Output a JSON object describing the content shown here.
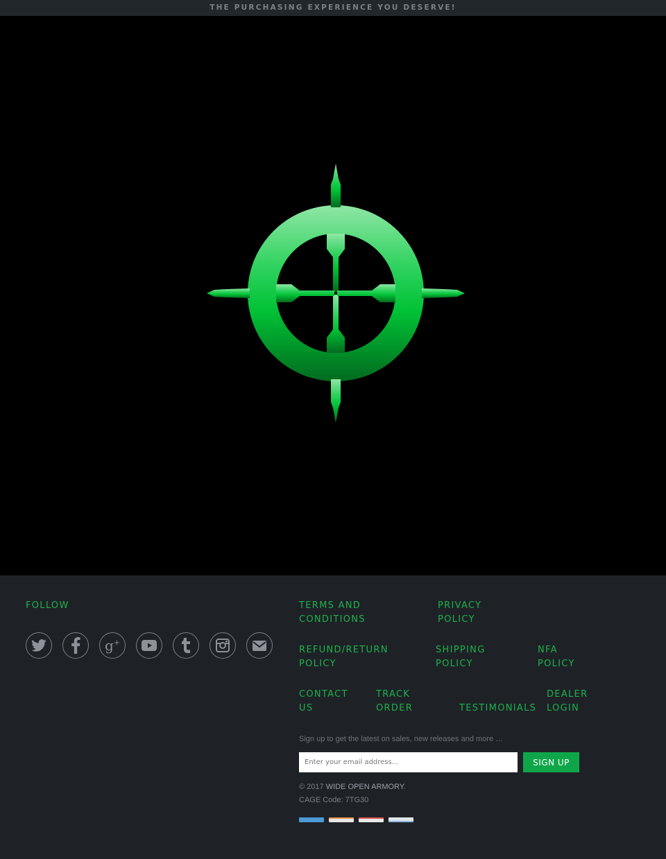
{
  "announcement": "THE PURCHASING EXPERIENCE YOU DESERVE!",
  "hero": {
    "logo_icon": "crosshair-scope-logo",
    "accent": "#00c93f",
    "background": "#000000"
  },
  "footer": {
    "follow_heading": "FOLLOW",
    "social": [
      {
        "name": "twitter-icon",
        "label": "Twitter"
      },
      {
        "name": "facebook-icon",
        "label": "Facebook"
      },
      {
        "name": "google-plus-icon",
        "label": "g+"
      },
      {
        "name": "youtube-icon",
        "label": "YouTube"
      },
      {
        "name": "tumblr-icon",
        "label": "Tumblr"
      },
      {
        "name": "instagram-icon",
        "label": "Instagram"
      },
      {
        "name": "email-icon",
        "label": "Email"
      }
    ],
    "links": {
      "terms": [
        "TERMS AND",
        "CONDITIONS"
      ],
      "privacy": [
        "PRIVACY",
        "POLICY"
      ],
      "refund": [
        "REFUND/RETURN",
        "POLICY"
      ],
      "shipping": [
        "SHIPPING",
        "POLICY"
      ],
      "nfa": [
        "NFA",
        "POLICY"
      ],
      "contact": [
        "CONTACT",
        "US"
      ],
      "track": [
        "TRACK",
        "ORDER"
      ],
      "testimonials": "TESTIMONIALS",
      "dealer": [
        "DEALER",
        "LOGIN"
      ]
    },
    "signup_text": "Sign up to get the latest on sales, new releases and more …",
    "email_placeholder": "Enter your email address...",
    "signup_button": "SIGN UP",
    "copyright_prefix": "© 2017",
    "company_name": "WIDE OPEN ARMORY",
    "cage_code": "CAGE Code: 7TG30",
    "payment_methods": [
      {
        "name": "american-express-icon",
        "color": "#4d9ad6"
      },
      {
        "name": "discover-icon",
        "color": "#e69245"
      },
      {
        "name": "mastercard-icon",
        "color": "#e0534a"
      },
      {
        "name": "visa-icon",
        "color": "#8fb4d9"
      }
    ],
    "link_color": "#1fb14b"
  }
}
